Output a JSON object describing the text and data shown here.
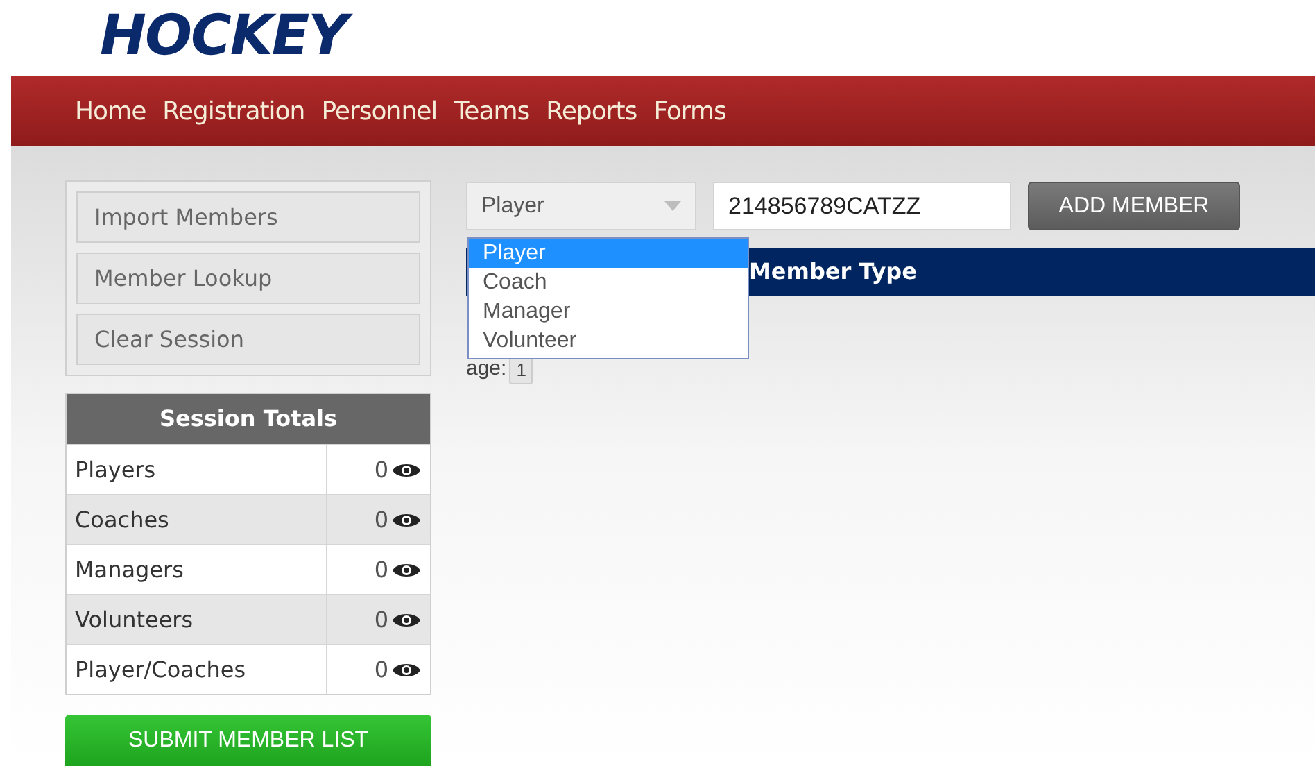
{
  "logo": {
    "text": "HOCKEY"
  },
  "nav": [
    {
      "label": "Home"
    },
    {
      "label": "Registration"
    },
    {
      "label": "Personnel"
    },
    {
      "label": "Teams"
    },
    {
      "label": "Reports"
    },
    {
      "label": "Forms"
    }
  ],
  "side_buttons": [
    {
      "label": "Import Members"
    },
    {
      "label": "Member Lookup"
    },
    {
      "label": "Clear Session"
    }
  ],
  "session_totals": {
    "title": "Session Totals",
    "rows": [
      {
        "label": "Players",
        "count": "0"
      },
      {
        "label": "Coaches",
        "count": "0"
      },
      {
        "label": "Managers",
        "count": "0"
      },
      {
        "label": "Volunteers",
        "count": "0"
      },
      {
        "label": "Player/Coaches",
        "count": "0"
      }
    ]
  },
  "submit_button": "SUBMIT MEMBER LIST",
  "member_type_select": {
    "value": "Player",
    "expanded": true,
    "options": [
      {
        "label": "Player",
        "selected": true
      },
      {
        "label": "Coach",
        "selected": false
      },
      {
        "label": "Manager",
        "selected": false
      },
      {
        "label": "Volunteer",
        "selected": false
      }
    ]
  },
  "member_id_field": {
    "value": "214856789CATZZ"
  },
  "add_button": "ADD MEMBER",
  "table": {
    "columns": [
      "Member Type"
    ]
  },
  "pager": {
    "label": "age:",
    "page": "1"
  }
}
